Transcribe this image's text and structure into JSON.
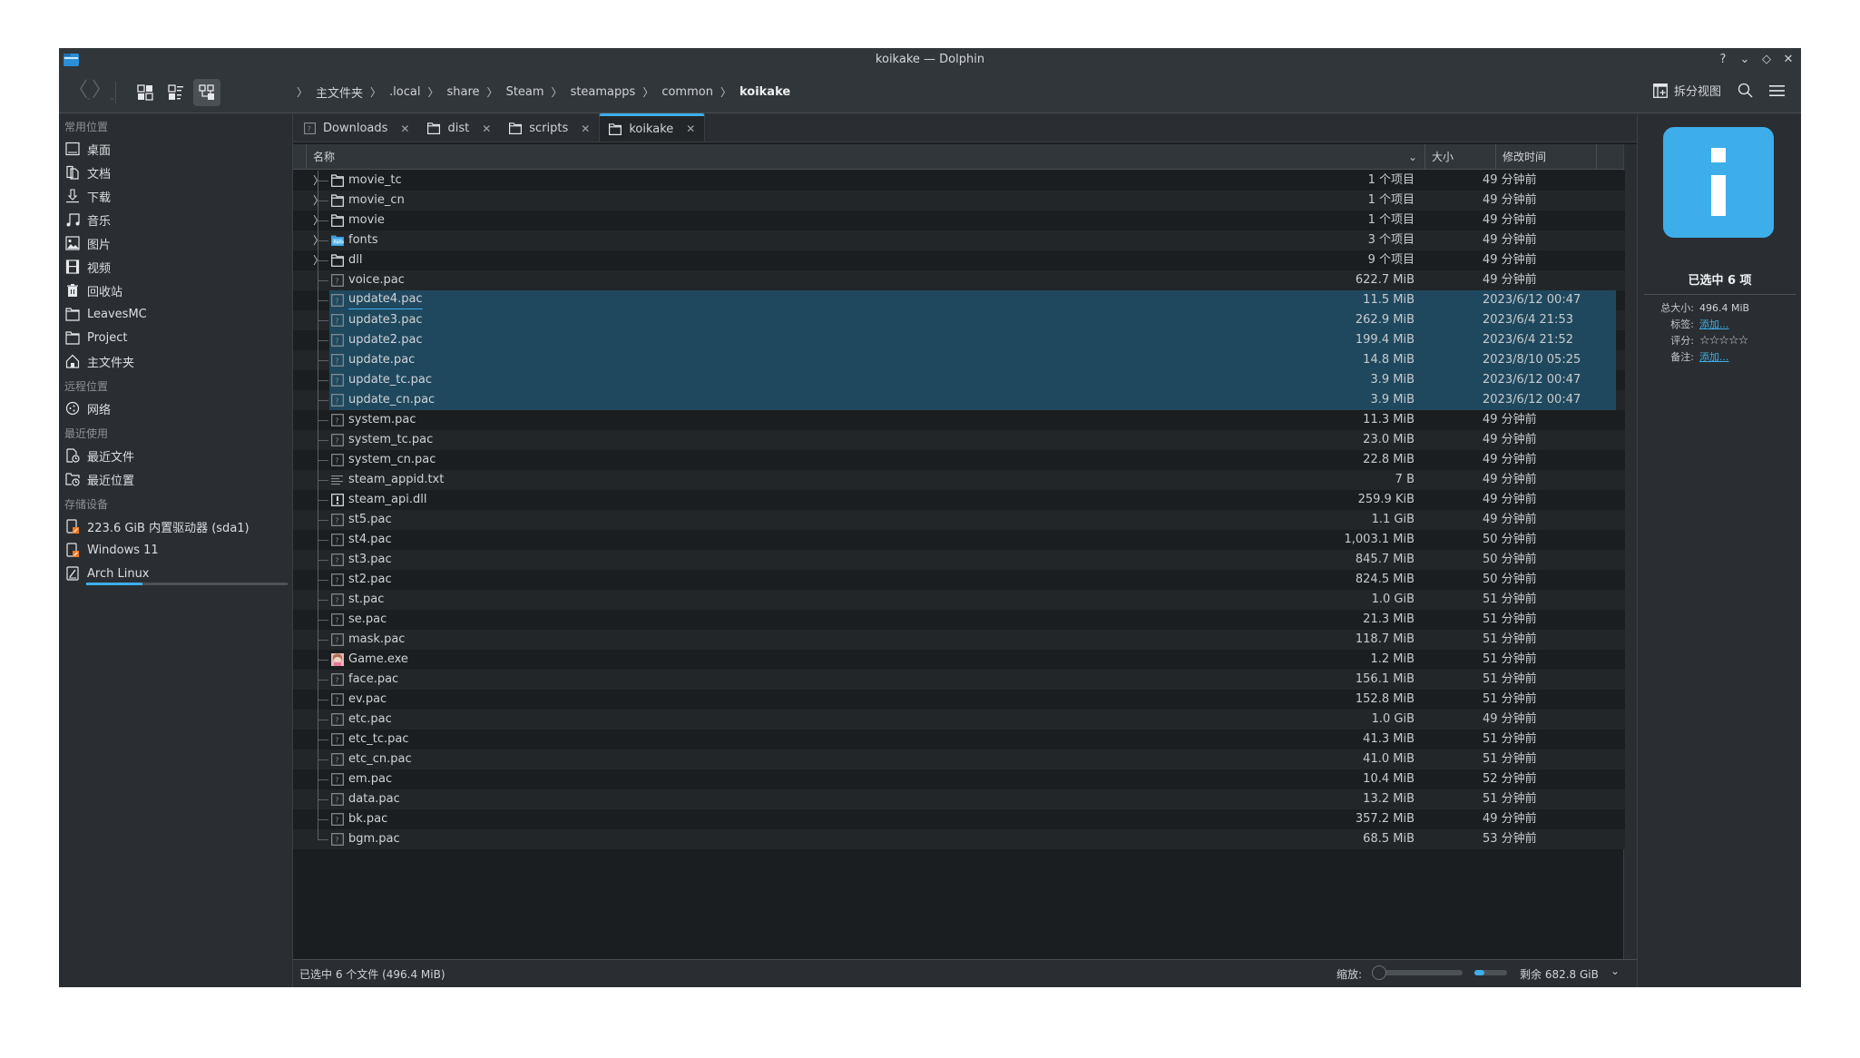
{
  "window": {
    "title": "koikake — Dolphin",
    "controls": [
      "?",
      "⌄",
      "◇",
      "✕"
    ]
  },
  "toolbar": {
    "back_glyph": "〈",
    "forward_glyph": "〉",
    "split_label": "拆分视图",
    "breadcrumb": [
      "主文件夹",
      ".local",
      "share",
      "Steam",
      "steamapps",
      "common",
      "koikake"
    ],
    "breadcrumb_sep": "〉"
  },
  "sidebar": {
    "sections": [
      {
        "title": "常用位置",
        "items": [
          {
            "label": "桌面",
            "icon": "desktop-icon"
          },
          {
            "label": "文档",
            "icon": "documents-icon"
          },
          {
            "label": "下载",
            "icon": "download-icon"
          },
          {
            "label": "音乐",
            "icon": "music-icon"
          },
          {
            "label": "图片",
            "icon": "pictures-icon"
          },
          {
            "label": "视频",
            "icon": "videos-icon"
          },
          {
            "label": "回收站",
            "icon": "trash-icon"
          },
          {
            "label": "LeavesMC",
            "icon": "folder-icon"
          },
          {
            "label": "Project",
            "icon": "folder-icon"
          },
          {
            "label": "主文件夹",
            "icon": "home-icon"
          }
        ]
      },
      {
        "title": "远程位置",
        "items": [
          {
            "label": "网络",
            "icon": "network-icon"
          }
        ]
      },
      {
        "title": "最近使用",
        "items": [
          {
            "label": "最近文件",
            "icon": "recent-files-icon"
          },
          {
            "label": "最近位置",
            "icon": "recent-locations-icon"
          }
        ]
      },
      {
        "title": "存储设备",
        "items": [
          {
            "label": "223.6 GiB 内置驱动器 (sda1)",
            "icon": "drive-icon"
          },
          {
            "label": "Windows 11",
            "icon": "drive-icon"
          },
          {
            "label": "Arch Linux",
            "icon": "root-drive-icon",
            "usage_fraction": 0.28
          }
        ]
      }
    ]
  },
  "tabs": [
    {
      "label": "Downloads",
      "icon": "unknown-folder-icon",
      "active": false
    },
    {
      "label": "dist",
      "icon": "folder-icon",
      "active": false
    },
    {
      "label": "scripts",
      "icon": "folder-icon",
      "active": false
    },
    {
      "label": "koikake",
      "icon": "folder-icon",
      "active": true
    }
  ],
  "tab_close_glyph": "✕",
  "columns": {
    "name": "名称",
    "size": "大小",
    "modified": "修改时间"
  },
  "files": [
    {
      "name": "movie_tc",
      "type": "folder",
      "size": "1 个项目",
      "modified": "49 分钟前",
      "selected": false
    },
    {
      "name": "movie_cn",
      "type": "folder",
      "size": "1 个项目",
      "modified": "49 分钟前",
      "selected": false
    },
    {
      "name": "movie",
      "type": "folder",
      "size": "1 个项目",
      "modified": "49 分钟前",
      "selected": false
    },
    {
      "name": "fonts",
      "type": "fonts-folder",
      "size": "3 个项目",
      "modified": "49 分钟前",
      "selected": false
    },
    {
      "name": "dll",
      "type": "folder",
      "size": "9 个项目",
      "modified": "49 分钟前",
      "selected": false
    },
    {
      "name": "voice.pac",
      "type": "unknown",
      "size": "622.7 MiB",
      "modified": "49 分钟前",
      "selected": false
    },
    {
      "name": "update4.pac",
      "type": "unknown",
      "size": "11.5 MiB",
      "modified": "2023/6/12 00:47",
      "selected": true,
      "focused": true
    },
    {
      "name": "update3.pac",
      "type": "unknown",
      "size": "262.9 MiB",
      "modified": "2023/6/4 21:53",
      "selected": true
    },
    {
      "name": "update2.pac",
      "type": "unknown",
      "size": "199.4 MiB",
      "modified": "2023/6/4 21:52",
      "selected": true
    },
    {
      "name": "update.pac",
      "type": "unknown",
      "size": "14.8 MiB",
      "modified": "2023/8/10 05:25",
      "selected": true
    },
    {
      "name": "update_tc.pac",
      "type": "unknown",
      "size": "3.9 MiB",
      "modified": "2023/6/12 00:47",
      "selected": true
    },
    {
      "name": "update_cn.pac",
      "type": "unknown",
      "size": "3.9 MiB",
      "modified": "2023/6/12 00:47",
      "selected": true
    },
    {
      "name": "system.pac",
      "type": "unknown",
      "size": "11.3 MiB",
      "modified": "49 分钟前",
      "selected": false
    },
    {
      "name": "system_tc.pac",
      "type": "unknown",
      "size": "23.0 MiB",
      "modified": "49 分钟前",
      "selected": false
    },
    {
      "name": "system_cn.pac",
      "type": "unknown",
      "size": "22.8 MiB",
      "modified": "49 分钟前",
      "selected": false
    },
    {
      "name": "steam_appid.txt",
      "type": "text",
      "size": "7 B",
      "modified": "49 分钟前",
      "selected": false
    },
    {
      "name": "steam_api.dll",
      "type": "dll",
      "size": "259.9 KiB",
      "modified": "49 分钟前",
      "selected": false
    },
    {
      "name": "st5.pac",
      "type": "unknown",
      "size": "1.1 GiB",
      "modified": "49 分钟前",
      "selected": false
    },
    {
      "name": "st4.pac",
      "type": "unknown",
      "size": "1,003.1 MiB",
      "modified": "50 分钟前",
      "selected": false
    },
    {
      "name": "st3.pac",
      "type": "unknown",
      "size": "845.7 MiB",
      "modified": "50 分钟前",
      "selected": false
    },
    {
      "name": "st2.pac",
      "type": "unknown",
      "size": "824.5 MiB",
      "modified": "50 分钟前",
      "selected": false
    },
    {
      "name": "st.pac",
      "type": "unknown",
      "size": "1.0 GiB",
      "modified": "51 分钟前",
      "selected": false
    },
    {
      "name": "se.pac",
      "type": "unknown",
      "size": "21.3 MiB",
      "modified": "51 分钟前",
      "selected": false
    },
    {
      "name": "mask.pac",
      "type": "unknown",
      "size": "118.7 MiB",
      "modified": "51 分钟前",
      "selected": false
    },
    {
      "name": "Game.exe",
      "type": "exe",
      "size": "1.2 MiB",
      "modified": "51 分钟前",
      "selected": false
    },
    {
      "name": "face.pac",
      "type": "unknown",
      "size": "156.1 MiB",
      "modified": "51 分钟前",
      "selected": false
    },
    {
      "name": "ev.pac",
      "type": "unknown",
      "size": "152.8 MiB",
      "modified": "51 分钟前",
      "selected": false
    },
    {
      "name": "etc.pac",
      "type": "unknown",
      "size": "1.0 GiB",
      "modified": "49 分钟前",
      "selected": false
    },
    {
      "name": "etc_tc.pac",
      "type": "unknown",
      "size": "41.3 MiB",
      "modified": "51 分钟前",
      "selected": false
    },
    {
      "name": "etc_cn.pac",
      "type": "unknown",
      "size": "41.0 MiB",
      "modified": "51 分钟前",
      "selected": false
    },
    {
      "name": "em.pac",
      "type": "unknown",
      "size": "10.4 MiB",
      "modified": "52 分钟前",
      "selected": false
    },
    {
      "name": "data.pac",
      "type": "unknown",
      "size": "13.2 MiB",
      "modified": "51 分钟前",
      "selected": false
    },
    {
      "name": "bk.pac",
      "type": "unknown",
      "size": "357.2 MiB",
      "modified": "49 分钟前",
      "selected": false
    },
    {
      "name": "bgm.pac",
      "type": "unknown",
      "size": "68.5 MiB",
      "modified": "53 分钟前",
      "selected": false
    }
  ],
  "statusbar": {
    "selection_text": "已选中 6 个文件 (496.4 MiB)",
    "zoom_label": "缩放:",
    "zoom_fraction": 0.0,
    "free_space_text": "剩余 682.8 GiB",
    "used_space_fraction": 0.3
  },
  "info_panel": {
    "title": "已选中 6 项",
    "fields": [
      {
        "key": "总大小:",
        "value": "496.4 MiB",
        "type": "text"
      },
      {
        "key": "标签:",
        "value": "添加...",
        "type": "link"
      },
      {
        "key": "评分:",
        "value": "☆☆☆☆☆",
        "type": "rating",
        "rating": 0,
        "max": 5
      },
      {
        "key": "备注:",
        "value": "添加...",
        "type": "link"
      }
    ]
  },
  "colors": {
    "accent": "#3daee9",
    "selection": "#1f485e",
    "window_bg": "#2a2e32",
    "view_bg": "#1b1e20"
  }
}
